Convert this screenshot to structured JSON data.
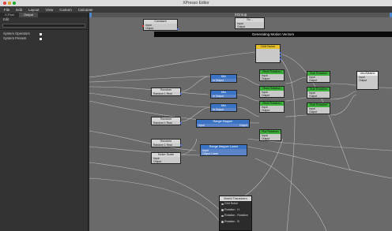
{
  "window": {
    "title": "XPresso Editor"
  },
  "menu": [
    "File",
    "Edit",
    "Layout",
    "View",
    "Custom",
    "Calculate"
  ],
  "left_panel": {
    "tabs": [
      "X-Pool",
      "Output"
    ],
    "root_label": "Edit",
    "items": [
      "System Operators",
      "System Presets"
    ]
  },
  "canvas": {
    "group_title": "XGroup",
    "banner": "Generating Motion Vectors"
  },
  "nodes": {
    "constant": {
      "title": "Constant",
      "rows": [
        "Input",
        "Output"
      ]
    },
    "top_small": {
      "title": "Sc...",
      "rows": [
        "Input",
        "Output"
      ]
    },
    "grid_noise_top": {
      "title": "Grid Noise"
    },
    "rotation_a": {
      "title": "Real Rotation",
      "rows": [
        "Input",
        "Output"
      ]
    },
    "rotation_b": {
      "title": "Sub Rotation",
      "rows": [
        "Input",
        "Output"
      ]
    },
    "rotation_c": {
      "title": "Real Rotation",
      "rows": [
        "Input",
        "Output"
      ]
    },
    "rotation_d": {
      "title": "Sub Rotation",
      "rows": [
        "Input",
        "Output"
      ]
    },
    "rotation_e": {
      "title": "Real Rotation",
      "rows": [
        "Input",
        "Output"
      ]
    },
    "rotation_f": {
      "title": "Sub Rotation",
      "rows": [
        "Input",
        "Output"
      ]
    },
    "right_out": {
      "title": "Vec2Matrix",
      "rows": [
        "Input",
        "Output"
      ]
    },
    "random1": {
      "title": "Random",
      "rows": [
        "Random 1 Real"
      ]
    },
    "random2": {
      "title": "Random",
      "rows": [
        "Random 1 Real"
      ]
    },
    "random3": {
      "title": "Random",
      "rows": [
        "Random 1 Real"
      ]
    },
    "mid1": {
      "title": "Mix",
      "rows": [
        "In Output"
      ]
    },
    "mid2": {
      "title": "Mix",
      "rows": [
        "In Output"
      ]
    },
    "mid3": {
      "title": "Mix",
      "rows": [
        "In Output"
      ]
    },
    "range_mapper": {
      "title": "Range Mapper",
      "rows": [
        "Input",
        "Output"
      ]
    },
    "noise_scale": {
      "title": "Noise Scale",
      "rows": [
        "Input",
        "Output"
      ]
    },
    "output_lower": {
      "title": "Range Mapper Lower",
      "rows": [
        "Input",
        "Output Lower"
      ]
    },
    "rot_small": {
      "title": "Rot Rotation",
      "rows": [
        "Input",
        "Output"
      ]
    },
    "world_transform": {
      "title": "World Transform",
      "rows": [
        "Grid Noise",
        "Rotation . H",
        "Rotation . Rotation",
        "Rotation . B"
      ]
    }
  }
}
